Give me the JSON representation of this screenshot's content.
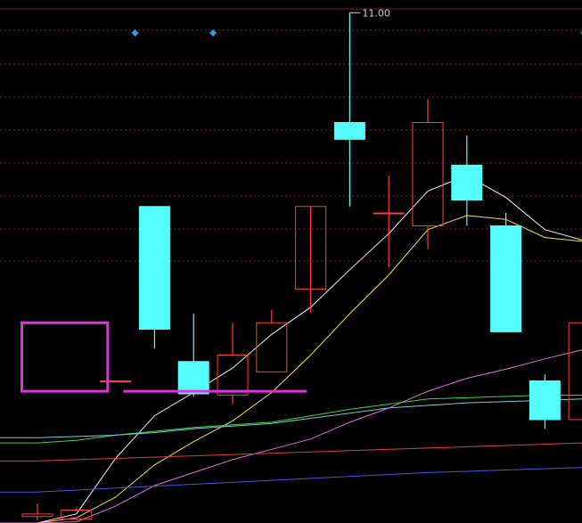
{
  "chart_data": {
    "type": "candlestick",
    "title": "",
    "xlabel": "",
    "ylabel": "",
    "ylim": [
      7.05,
      11.36
    ],
    "grid": true,
    "x": [
      1,
      2,
      3,
      4,
      5,
      6,
      7,
      8,
      9,
      10,
      11,
      12,
      13,
      14,
      15,
      16
    ],
    "ohlc": [
      {
        "i": 1,
        "open": 7.1,
        "high": 7.2,
        "low": 7.07,
        "close": 7.12
      },
      {
        "i": 2,
        "open": 7.08,
        "high": 7.17,
        "low": 7.07,
        "close": 7.15
      },
      {
        "i": 3,
        "open": 8.15,
        "high": 8.15,
        "low": 8.15,
        "close": 8.15
      },
      {
        "i": 4,
        "open": 9.5,
        "high": 9.5,
        "low": 8.4,
        "close": 8.55
      },
      {
        "i": 5,
        "open": 8.3,
        "high": 8.67,
        "low": 8.03,
        "close": 8.05
      },
      {
        "i": 6,
        "open": 8.04,
        "high": 8.6,
        "low": 7.97,
        "close": 8.35
      },
      {
        "i": 7,
        "open": 8.22,
        "high": 8.7,
        "low": 8.22,
        "close": 8.6
      },
      {
        "i": 8,
        "open": 8.86,
        "high": 8.86,
        "low": 8.68,
        "close": 9.5
      },
      {
        "i": 9,
        "open": 10.15,
        "high": 11.0,
        "low": 9.5,
        "close": 10.02
      },
      {
        "i": 10,
        "open": 9.45,
        "high": 9.74,
        "low": 9.03,
        "close": 9.45
      },
      {
        "i": 11,
        "open": 9.35,
        "high": 10.33,
        "low": 9.17,
        "close": 10.15
      },
      {
        "i": 12,
        "open": 9.82,
        "high": 10.05,
        "low": 9.35,
        "close": 9.55
      },
      {
        "i": 13,
        "open": 9.35,
        "high": 9.45,
        "low": 8.53,
        "close": 8.53
      },
      {
        "i": 14,
        "open": 8.15,
        "high": 8.2,
        "low": 7.78,
        "close": 7.85
      },
      {
        "i": 15,
        "open": 7.85,
        "high": 8.6,
        "low": 7.85,
        "close": 8.6
      }
    ],
    "moving_averages": [
      {
        "color": "#f0f0f0",
        "points": [
          [
            1,
            7.05
          ],
          [
            2,
            7.12
          ],
          [
            3,
            7.55
          ],
          [
            4,
            7.88
          ],
          [
            5,
            8.06
          ],
          [
            6,
            8.25
          ],
          [
            7,
            8.51
          ],
          [
            8,
            8.72
          ],
          [
            9,
            9.01
          ],
          [
            10,
            9.29
          ],
          [
            11,
            9.62
          ],
          [
            12,
            9.74
          ],
          [
            13,
            9.57
          ],
          [
            14,
            9.32
          ],
          [
            15,
            9.24
          ]
        ]
      },
      {
        "color": "#e8e83a",
        "points": [
          [
            1,
            7.05
          ],
          [
            2,
            7.09
          ],
          [
            3,
            7.25
          ],
          [
            4,
            7.5
          ],
          [
            5,
            7.68
          ],
          [
            6,
            7.84
          ],
          [
            7,
            8.06
          ],
          [
            8,
            8.35
          ],
          [
            9,
            8.67
          ],
          [
            10,
            8.97
          ],
          [
            11,
            9.32
          ],
          [
            12,
            9.43
          ],
          [
            13,
            9.4
          ],
          [
            14,
            9.26
          ],
          [
            15,
            9.23
          ]
        ]
      },
      {
        "color": "#e070e0",
        "points": [
          [
            1,
            7.05
          ],
          [
            2,
            7.06
          ],
          [
            3,
            7.18
          ],
          [
            4,
            7.34
          ],
          [
            5,
            7.44
          ],
          [
            6,
            7.54
          ],
          [
            7,
            7.62
          ],
          [
            8,
            7.7
          ],
          [
            9,
            7.83
          ],
          [
            10,
            7.94
          ],
          [
            11,
            8.07
          ],
          [
            12,
            8.17
          ],
          [
            13,
            8.24
          ],
          [
            14,
            8.32
          ],
          [
            15,
            8.39
          ]
        ]
      },
      {
        "color": "#3fd23f",
        "points": [
          [
            1,
            7.67
          ],
          [
            2,
            7.69
          ],
          [
            3,
            7.73
          ],
          [
            4,
            7.76
          ],
          [
            5,
            7.79
          ],
          [
            6,
            7.81
          ],
          [
            7,
            7.83
          ],
          [
            8,
            7.88
          ],
          [
            9,
            7.93
          ],
          [
            10,
            7.97
          ],
          [
            11,
            8.01
          ],
          [
            12,
            8.02
          ],
          [
            13,
            8.03
          ],
          [
            14,
            8.04
          ],
          [
            15,
            8.04
          ]
        ]
      },
      {
        "color": "#6ad0e0",
        "points": [
          [
            1,
            7.71
          ],
          [
            2,
            7.72
          ],
          [
            3,
            7.73
          ],
          [
            4,
            7.75
          ],
          [
            5,
            7.78
          ],
          [
            6,
            7.8
          ],
          [
            7,
            7.82
          ],
          [
            8,
            7.86
          ],
          [
            9,
            7.9
          ],
          [
            10,
            7.94
          ],
          [
            11,
            7.96
          ],
          [
            12,
            7.98
          ],
          [
            13,
            7.99
          ],
          [
            14,
            8.0
          ],
          [
            15,
            8.01
          ]
        ]
      },
      {
        "color": "#d84040",
        "points": [
          [
            1,
            7.53
          ],
          [
            3,
            7.55
          ],
          [
            5,
            7.57
          ],
          [
            7,
            7.59
          ],
          [
            9,
            7.61
          ],
          [
            11,
            7.63
          ],
          [
            13,
            7.65
          ],
          [
            15,
            7.67
          ]
        ]
      },
      {
        "color": "#5050e0",
        "points": [
          [
            1,
            7.29
          ],
          [
            3,
            7.32
          ],
          [
            5,
            7.35
          ],
          [
            7,
            7.38
          ],
          [
            9,
            7.41
          ],
          [
            11,
            7.44
          ],
          [
            13,
            7.46
          ],
          [
            15,
            7.48
          ]
        ]
      }
    ],
    "annotations": [
      {
        "text": "11.00",
        "x": 9,
        "y": 11.0
      }
    ],
    "markers": [
      {
        "type": "diamond",
        "x": 3.5
      },
      {
        "type": "diamond",
        "x": 5.5
      },
      {
        "type": "diamond",
        "x": 15.0
      }
    ],
    "boxes": [
      {
        "x0": 0.6,
        "x1": 2.8,
        "y0": 8.07,
        "y1": 8.6,
        "color": "#e030e0"
      }
    ],
    "hlines": [
      {
        "x0": 3.2,
        "x1": 7.9,
        "y": 8.07,
        "color": "#e030e0"
      }
    ],
    "colors": {
      "background": "#000000",
      "grid": "#8a1c1c",
      "up": "#ff3c3c",
      "down": "#54fcfc",
      "marker": "#2aa3d8"
    }
  }
}
